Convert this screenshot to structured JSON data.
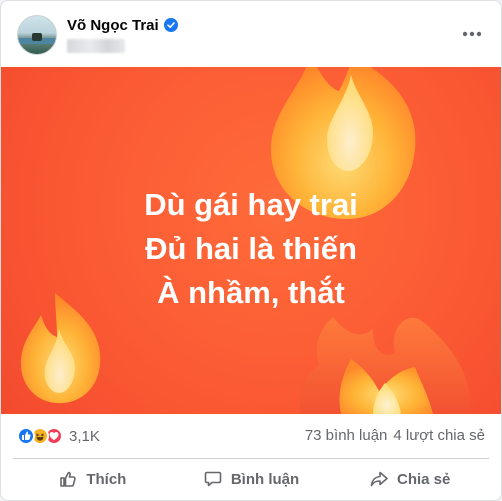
{
  "post": {
    "author_name": "Võ Ngọc Trai",
    "verified_icon": "verified-badge-icon",
    "more_icon": "more-options-icon",
    "caption_lines": [
      "Dù gái hay trai",
      "Đủ hai là thiến",
      "À nhầm, thắt"
    ],
    "colors": {
      "accent": "#1877f2",
      "media_background": "#fb5a34",
      "caption_text": "#ffffff"
    }
  },
  "stats": {
    "reaction_icons": [
      "like-icon",
      "haha-icon",
      "love-icon"
    ],
    "reaction_count": "3,1K",
    "comments": "73 bình luận",
    "shares": "4 lượt chia sẻ"
  },
  "actions": {
    "like": {
      "label": "Thích",
      "icon": "thumbs-up-icon"
    },
    "comment": {
      "label": "Bình luận",
      "icon": "comment-icon"
    },
    "share": {
      "label": "Chia sẻ",
      "icon": "share-icon"
    }
  }
}
